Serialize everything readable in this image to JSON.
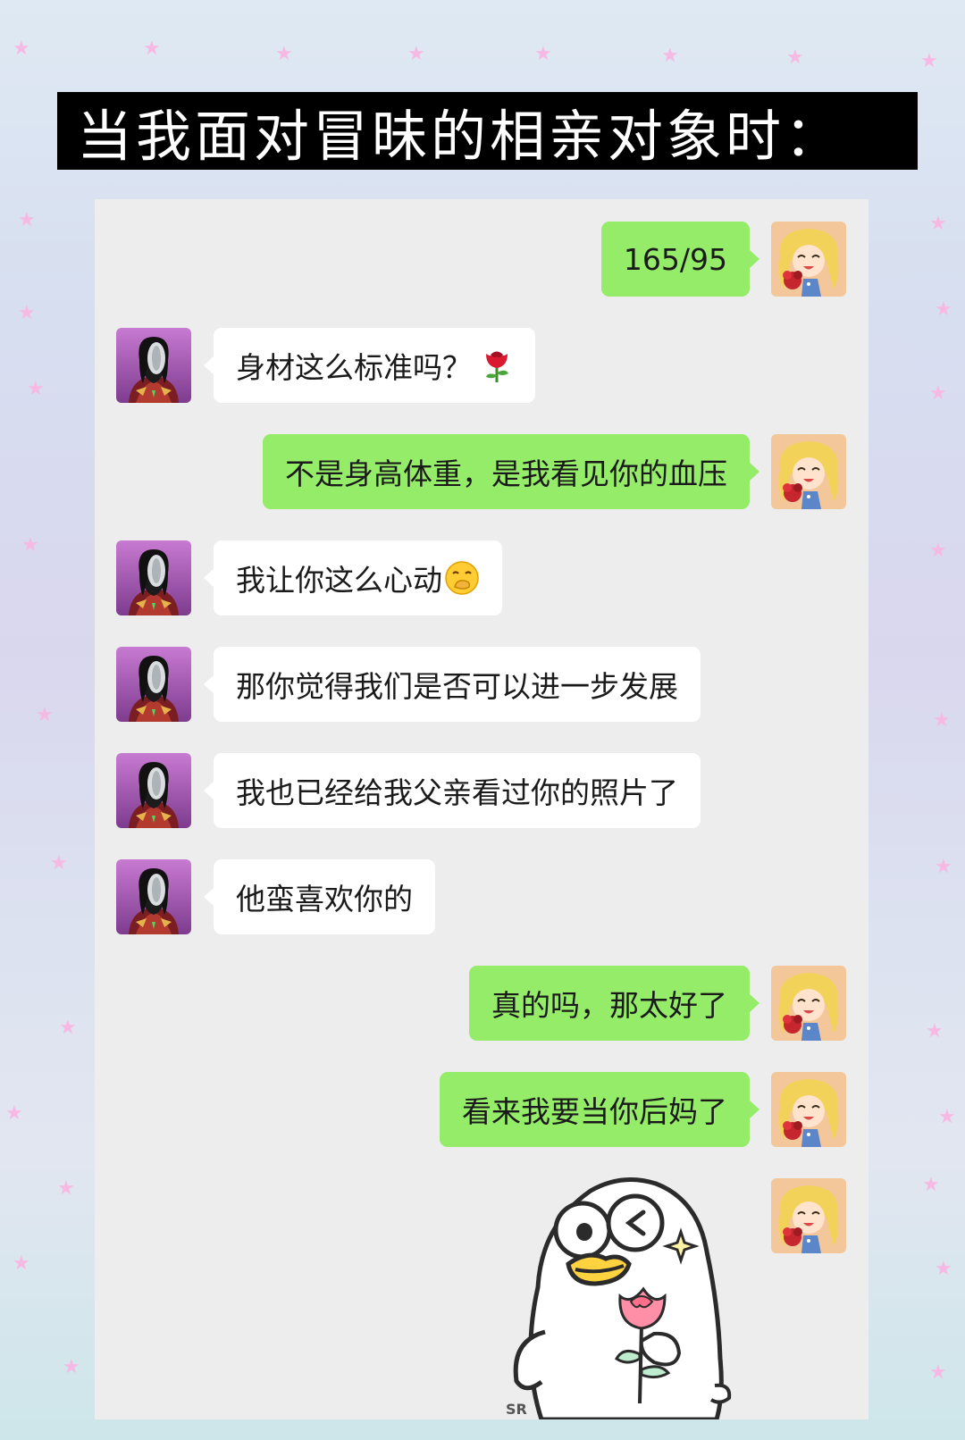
{
  "title": "当我面对冒昧的相亲对象时：",
  "colors": {
    "sent_bubble": "#95ec69",
    "received_bubble": "#ffffff",
    "chat_background": "#ededed",
    "title_background": "#000000",
    "star_decoration": "#f6b9e3"
  },
  "messages": [
    {
      "side": "right",
      "avatar": "cartoon-girl-with-roses-avatar",
      "text": "165/95"
    },
    {
      "side": "left",
      "avatar": "masked-hero-avatar",
      "text": "身材这么标准吗？",
      "emoji": "🌹"
    },
    {
      "side": "right",
      "avatar": "cartoon-girl-with-roses-avatar",
      "text": "不是身高体重，是我看见你的血压"
    },
    {
      "side": "left",
      "avatar": "masked-hero-avatar",
      "text": "我让你这么心动",
      "emoji": "🤭"
    },
    {
      "side": "left",
      "avatar": "masked-hero-avatar",
      "text": "那你觉得我们是否可以进一步发展"
    },
    {
      "side": "left",
      "avatar": "masked-hero-avatar",
      "text": "我也已经给我父亲看过你的照片了"
    },
    {
      "side": "left",
      "avatar": "masked-hero-avatar",
      "text": "他蛮喜欢你的"
    },
    {
      "side": "right",
      "avatar": "cartoon-girl-with-roses-avatar",
      "text": "真的吗，那太好了"
    },
    {
      "side": "right",
      "avatar": "cartoon-girl-with-roses-avatar",
      "text": "看来我要当你后妈了"
    }
  ],
  "sticker": {
    "side": "right",
    "avatar": "cartoon-girl-with-roses-avatar",
    "image": "duck-holding-rose-sticker",
    "watermark": "SR"
  }
}
